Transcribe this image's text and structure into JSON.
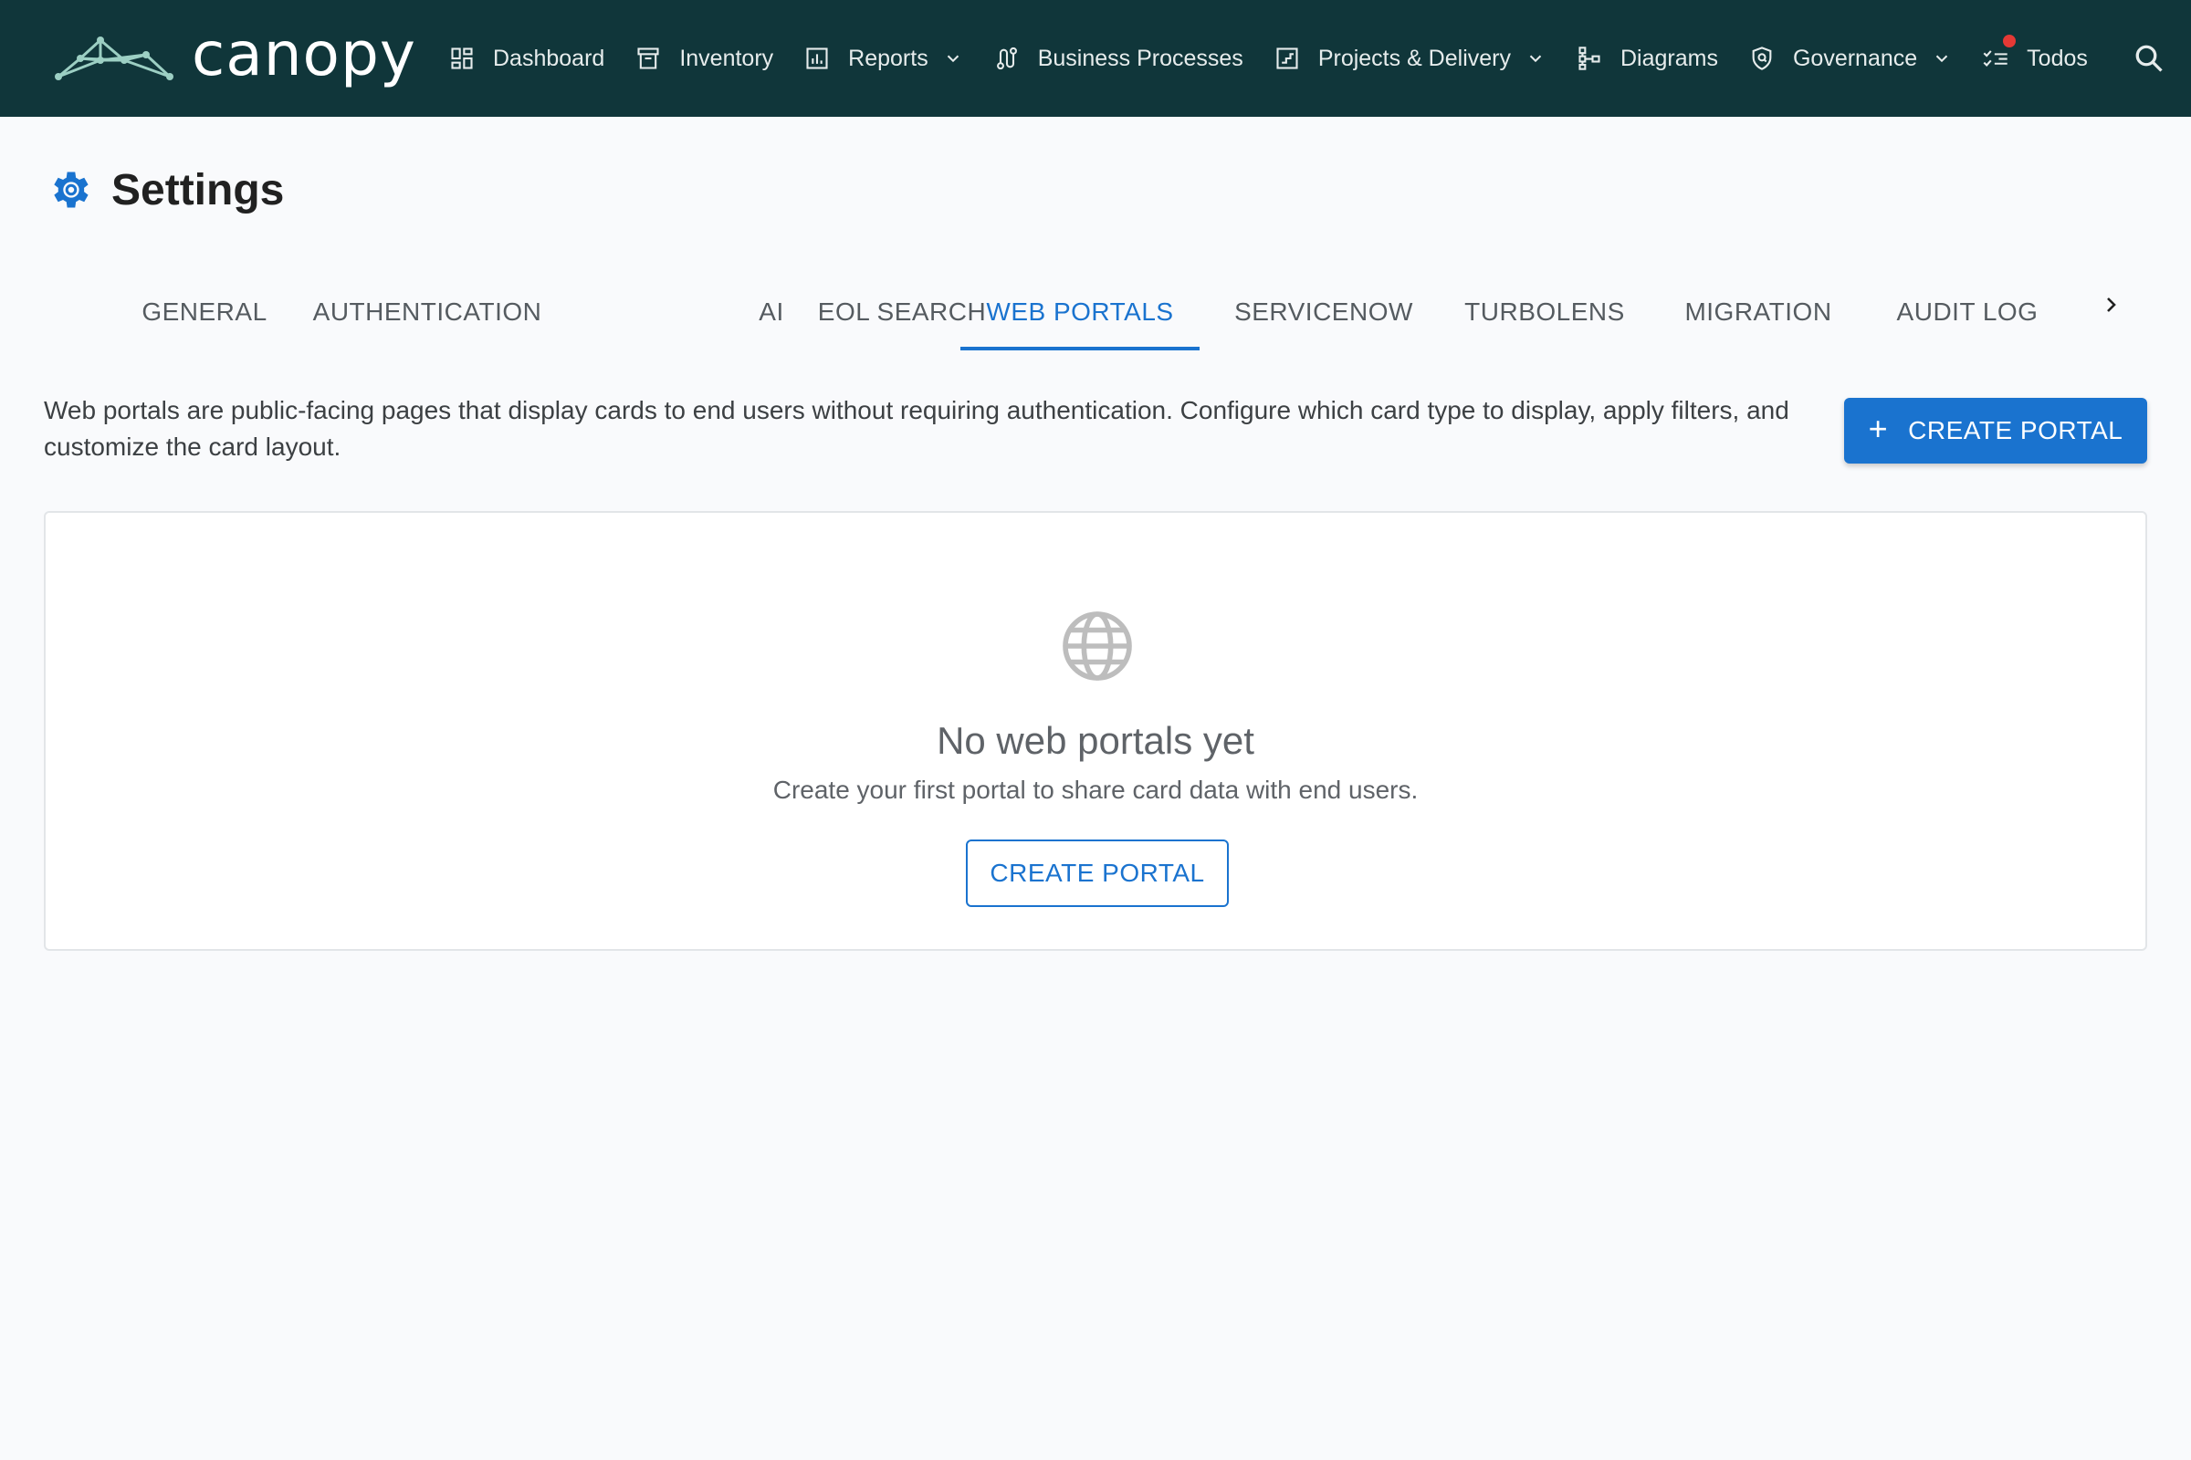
{
  "brand": {
    "name": "canopy"
  },
  "nav": {
    "items": [
      {
        "label": "Dashboard",
        "icon": "dashboard-icon",
        "dropdown": false
      },
      {
        "label": "Inventory",
        "icon": "archive-icon",
        "dropdown": false
      },
      {
        "label": "Reports",
        "icon": "bar-chart-icon",
        "dropdown": true
      },
      {
        "label": "Business Processes",
        "icon": "route-icon",
        "dropdown": false
      },
      {
        "label": "Projects & Delivery",
        "icon": "project-icon",
        "dropdown": true
      },
      {
        "label": "Diagrams",
        "icon": "diagram-icon",
        "dropdown": false
      },
      {
        "label": "Governance",
        "icon": "shield-icon",
        "dropdown": true
      },
      {
        "label": "Todos",
        "icon": "checklist-icon",
        "dropdown": false
      }
    ]
  },
  "page": {
    "title": "Settings"
  },
  "tabs": [
    {
      "label": "GENERAL",
      "active": false
    },
    {
      "label": "AUTHENTICATION",
      "active": false
    },
    {
      "label": "AI",
      "active": false
    },
    {
      "label": "EOL SEARCH",
      "active": false
    },
    {
      "label": "WEB PORTALS",
      "active": true
    },
    {
      "label": "SERVICENOW",
      "active": false
    },
    {
      "label": "TURBOLENS",
      "active": false
    },
    {
      "label": "MIGRATION",
      "active": false
    },
    {
      "label": "AUDIT LOG",
      "active": false
    }
  ],
  "portals": {
    "description": "Web portals are public-facing pages that display cards to end users without requiring authentication. Configure which card type to display, apply filters, and customize the card layout.",
    "create_label": "CREATE PORTAL",
    "empty": {
      "title": "No web portals yet",
      "subtitle": "Create your first portal to share card data with end users.",
      "button_label": "CREATE PORTAL"
    }
  },
  "colors": {
    "topbar": "#10363a",
    "accent": "#1a73cf",
    "background": "#f9fafc"
  }
}
